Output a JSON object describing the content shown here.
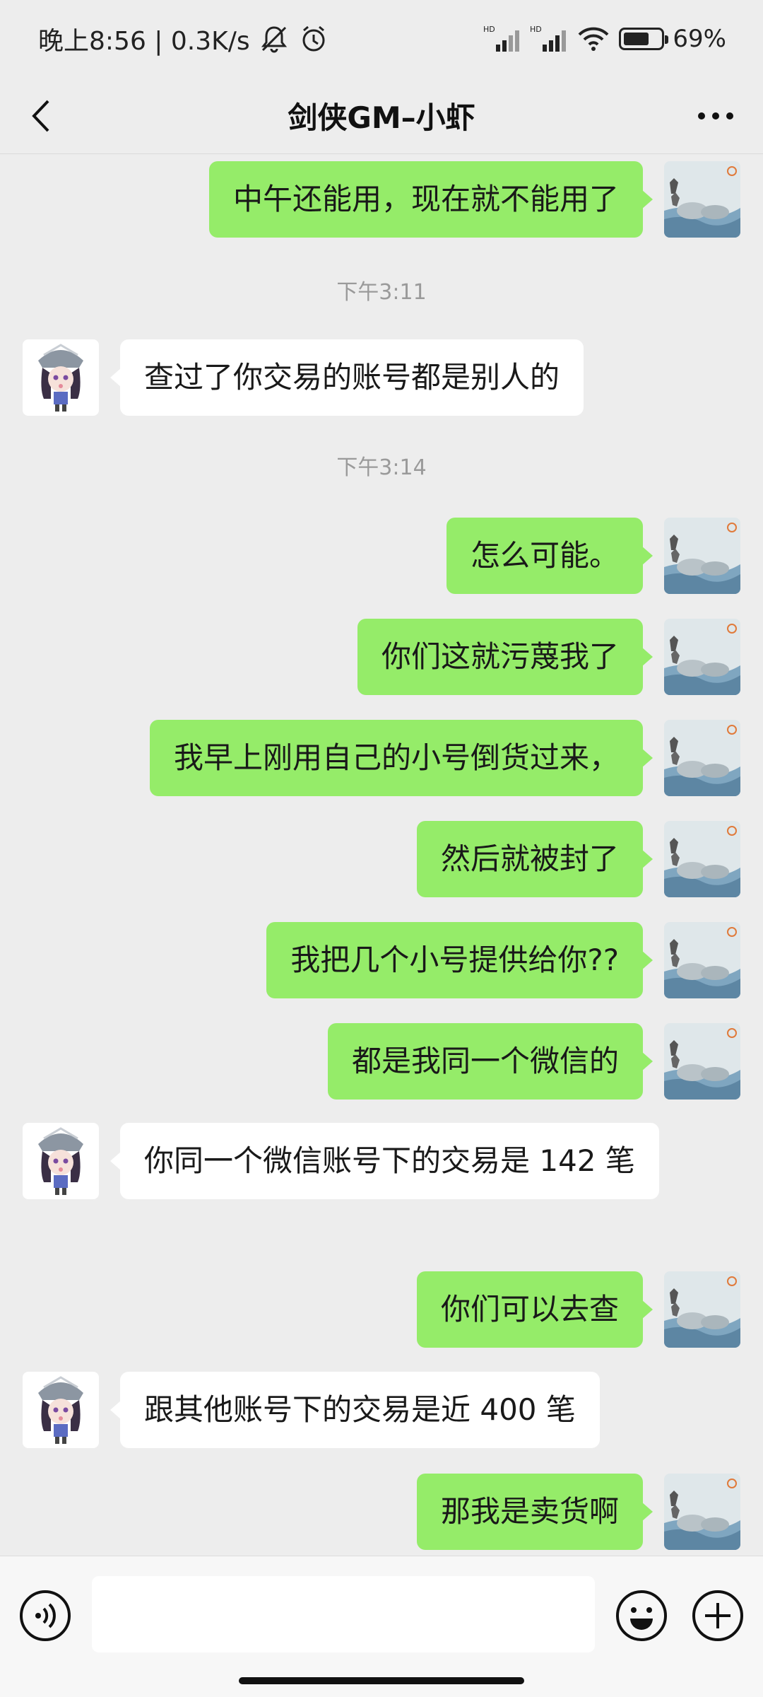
{
  "status_bar": {
    "time_label": "晚上8:56 | 0.3K/s",
    "battery_pct": "69%",
    "battery_level": 0.69,
    "icons": [
      "mute-icon",
      "alarm-icon",
      "hd-signal-icon",
      "hd-signal-icon",
      "wifi-icon",
      "battery-icon"
    ]
  },
  "header": {
    "title": "剑侠GM–小虾"
  },
  "messages": [
    {
      "side": "right",
      "text": "中午还能用，现在就不能用了"
    },
    {
      "type": "time",
      "text": "下午3:11"
    },
    {
      "side": "left",
      "text": "查过了你交易的账号都是别人的"
    },
    {
      "type": "time",
      "text": "下午3:14"
    },
    {
      "side": "right",
      "text": "怎么可能。"
    },
    {
      "side": "right",
      "text": "你们这就污蔑我了"
    },
    {
      "side": "right",
      "text": "我早上刚用自己的小号倒货过来，"
    },
    {
      "side": "right",
      "text": "然后就被封了"
    },
    {
      "side": "right",
      "text": "我把几个小号提供给你??"
    },
    {
      "side": "right",
      "text": "都是我同一个微信的"
    },
    {
      "side": "left",
      "text": "你同一个微信账号下的交易是 142 笔"
    },
    {
      "side": "right",
      "text": "你们可以去查"
    },
    {
      "side": "left",
      "text": "跟其他账号下的交易是近 400 笔"
    },
    {
      "side": "right",
      "text": "那我是卖货啊"
    }
  ],
  "input": {
    "value": "",
    "placeholder": ""
  },
  "colors": {
    "background": "#ededed",
    "bubble_self": "#95ec69",
    "bubble_other": "#ffffff"
  }
}
